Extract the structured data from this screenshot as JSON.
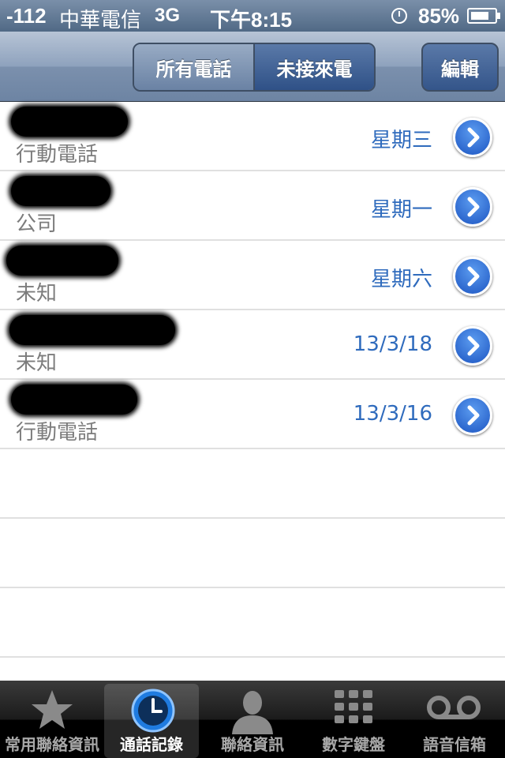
{
  "status_bar": {
    "signal": "-112",
    "carrier": "中華電信",
    "network": "3G",
    "time": "下午8:15",
    "battery_percent": "85%"
  },
  "nav": {
    "segments": [
      "所有電話",
      "未接來電"
    ],
    "selected_segment": 1,
    "edit_label": "編輯"
  },
  "calls": [
    {
      "type": "行動電話",
      "date": "星期三"
    },
    {
      "type": "公司",
      "date": "星期一"
    },
    {
      "type": "未知",
      "date": "星期六"
    },
    {
      "type": "未知",
      "date": "13/3/18"
    },
    {
      "type": "行動電話",
      "date": "13/3/16"
    }
  ],
  "tabs": [
    {
      "label": "常用聯絡資訊",
      "icon": "star-icon"
    },
    {
      "label": "通話記錄",
      "icon": "clock-icon"
    },
    {
      "label": "聯絡資訊",
      "icon": "person-icon"
    },
    {
      "label": "數字鍵盤",
      "icon": "keypad-icon"
    },
    {
      "label": "語音信箱",
      "icon": "voicemail-icon"
    }
  ],
  "selected_tab": 1,
  "colors": {
    "accent": "#2f6bbd",
    "nav": "#6d84a3"
  }
}
